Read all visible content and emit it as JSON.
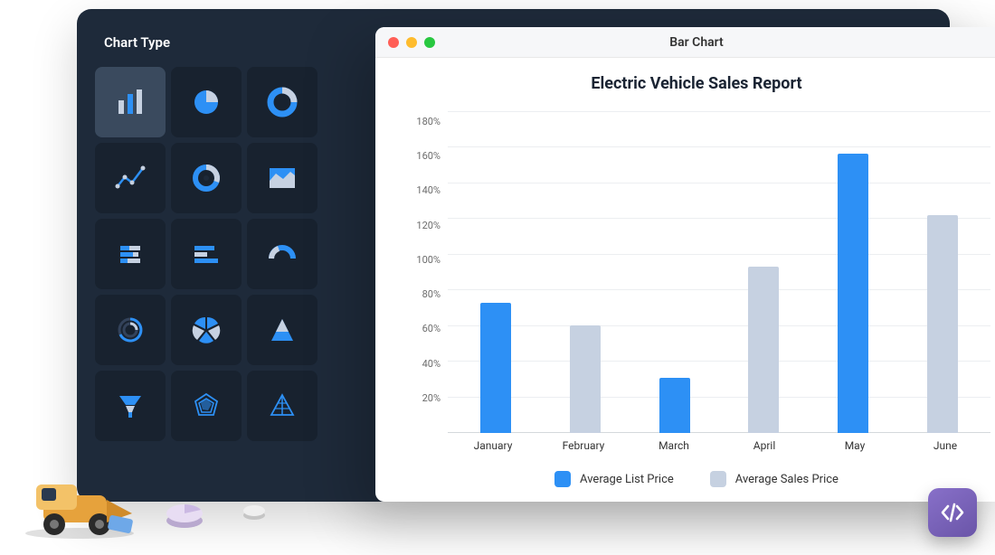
{
  "sidebar": {
    "title": "Chart Type",
    "types": [
      {
        "id": "bar-chart-icon",
        "active": true
      },
      {
        "id": "pie-chart-icon"
      },
      {
        "id": "donut-chart-icon"
      },
      {
        "id": "line-chart-icon"
      },
      {
        "id": "ring-chart-icon"
      },
      {
        "id": "area-chart-icon"
      },
      {
        "id": "stacked-bar-h-icon"
      },
      {
        "id": "horizontal-bar-icon"
      },
      {
        "id": "gauge-chart-icon"
      },
      {
        "id": "radial-bar-icon"
      },
      {
        "id": "broken-pie-icon"
      },
      {
        "id": "pyramid-chart-icon"
      },
      {
        "id": "funnel-chart-icon"
      },
      {
        "id": "radar-chart-icon"
      },
      {
        "id": "wireframe-pyramid-icon"
      }
    ]
  },
  "window": {
    "title": "Bar Chart"
  },
  "legend": {
    "series1": "Average List Price",
    "series2": "Average Sales Price"
  },
  "chart_data": {
    "type": "bar",
    "title": "Electric Vehicle Sales Report",
    "xlabel": "",
    "ylabel": "",
    "ylim": [
      0,
      180
    ],
    "ytick_labels": [
      "180%",
      "160%",
      "140%",
      "120%",
      "100%",
      "80%",
      "60%",
      "40%",
      "20%"
    ],
    "categories": [
      "January",
      "February",
      "March",
      "April",
      "May",
      "June"
    ],
    "series": [
      {
        "name": "Average List Price",
        "values": [
          73,
          0,
          31,
          0,
          156,
          0
        ]
      },
      {
        "name": "Average Sales Price",
        "values": [
          0,
          60,
          0,
          93,
          0,
          122
        ]
      }
    ]
  },
  "colors": {
    "primary": "#2d90f5",
    "secondary": "#c6d1e1",
    "panel": "#1e2a3a"
  }
}
